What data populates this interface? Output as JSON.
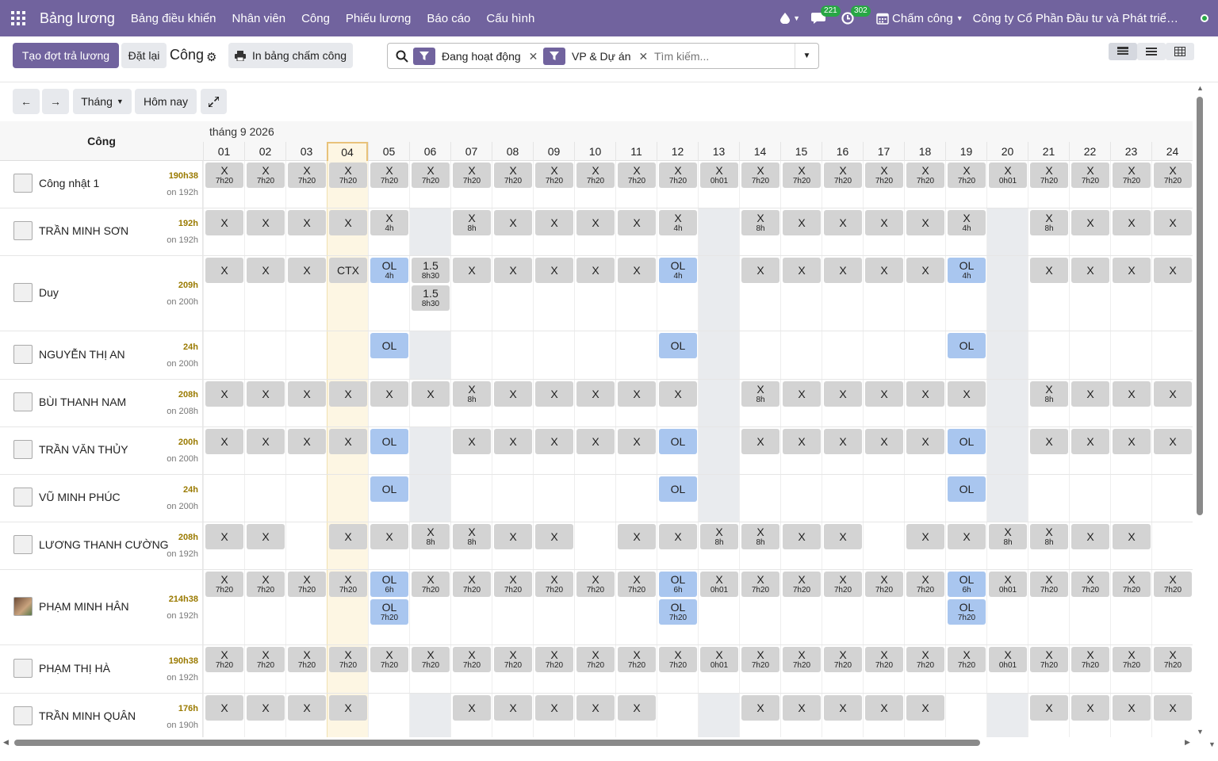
{
  "topbar": {
    "app_name": "Bảng lương",
    "menus": [
      "Bảng điều khiển",
      "Nhân viên",
      "Công",
      "Phiếu lương",
      "Báo cáo",
      "Cấu hình"
    ],
    "messages_count": "221",
    "activities_count": "302",
    "attendance_label": "Chấm công",
    "company": "Công ty Cổ Phần Đầu tư và Phát triể…",
    "accent": "#71639e"
  },
  "controls": {
    "create_payrun": "Tạo đợt trả lương",
    "reset": "Đặt lại",
    "title": "Công",
    "print": "In bảng chấm công"
  },
  "search": {
    "facets": [
      "Đang hoạt động",
      "VP & Dự án"
    ],
    "placeholder": "Tìm kiếm..."
  },
  "calendar": {
    "scale": "Tháng",
    "today": "Hôm nay",
    "month_label": "tháng 9 2026",
    "header_label": "Công",
    "days": [
      "01",
      "02",
      "03",
      "04",
      "05",
      "06",
      "07",
      "08",
      "09",
      "10",
      "11",
      "12",
      "13",
      "14",
      "15",
      "16",
      "17",
      "18",
      "19",
      "20",
      "21",
      "22",
      "23",
      "24"
    ],
    "today_index": 3,
    "off_days_note": "grey columns on days 06, 13, 20"
  },
  "employees": [
    {
      "name": "Công nhật 1",
      "hours": "190h38",
      "target": "on 192h",
      "avatar": "placeholder",
      "cells": [
        [
          "X",
          "7h20"
        ],
        [
          "X",
          "7h20"
        ],
        [
          "X",
          "7h20"
        ],
        [
          "X",
          "7h20"
        ],
        [
          "X",
          "7h20"
        ],
        [
          "X",
          "7h20"
        ],
        [
          "X",
          "7h20"
        ],
        [
          "X",
          "7h20"
        ],
        [
          "X",
          "7h20"
        ],
        [
          "X",
          "7h20"
        ],
        [
          "X",
          "7h20"
        ],
        [
          "X",
          "7h20"
        ],
        [
          "X",
          "0h01"
        ],
        [
          "X",
          "7h20"
        ],
        [
          "X",
          "7h20"
        ],
        [
          "X",
          "7h20"
        ],
        [
          "X",
          "7h20"
        ],
        [
          "X",
          "7h20"
        ],
        [
          "X",
          "7h20"
        ],
        [
          "X",
          "0h01"
        ],
        [
          "X",
          "7h20"
        ],
        [
          "X",
          "7h20"
        ],
        [
          "X",
          "7h20"
        ],
        [
          "X",
          "7h20"
        ]
      ]
    },
    {
      "name": "TRẦN MINH SƠN",
      "hours": "192h",
      "target": "on 192h",
      "avatar": "placeholder",
      "cells": [
        [
          "X",
          ""
        ],
        [
          "X",
          ""
        ],
        [
          "X",
          ""
        ],
        [
          "X",
          ""
        ],
        [
          "X",
          "4h"
        ],
        null,
        [
          "X",
          "8h"
        ],
        [
          "X",
          ""
        ],
        [
          "X",
          ""
        ],
        [
          "X",
          ""
        ],
        [
          "X",
          ""
        ],
        [
          "X",
          "4h"
        ],
        null,
        [
          "X",
          "8h"
        ],
        [
          "X",
          ""
        ],
        [
          "X",
          ""
        ],
        [
          "X",
          ""
        ],
        [
          "X",
          ""
        ],
        [
          "X",
          "4h"
        ],
        null,
        [
          "X",
          "8h"
        ],
        [
          "X",
          ""
        ],
        [
          "X",
          ""
        ],
        [
          "X",
          ""
        ]
      ]
    },
    {
      "name": "Duy",
      "hours": "209h",
      "target": "on 200h",
      "avatar": "placeholder",
      "cells": [
        [
          "X",
          ""
        ],
        [
          "X",
          ""
        ],
        [
          "X",
          ""
        ],
        [
          "CTX",
          ""
        ],
        [
          "OL",
          "4h"
        ],
        [
          "1.5",
          "8h30"
        ],
        [
          "X",
          ""
        ],
        [
          "X",
          ""
        ],
        [
          "X",
          ""
        ],
        [
          "X",
          ""
        ],
        [
          "X",
          ""
        ],
        [
          "OL",
          "4h"
        ],
        null,
        [
          "X",
          ""
        ],
        [
          "X",
          ""
        ],
        [
          "X",
          ""
        ],
        [
          "X",
          ""
        ],
        [
          "X",
          ""
        ],
        [
          "OL",
          "4h"
        ],
        null,
        [
          "X",
          ""
        ],
        [
          "X",
          ""
        ],
        [
          "X",
          ""
        ],
        [
          "X",
          ""
        ]
      ],
      "extra": {
        "day_index": 5,
        "label": "1.5",
        "sub": "8h30"
      }
    },
    {
      "name": "NGUYỄN THỊ AN",
      "hours": "24h",
      "target": "on 200h",
      "avatar": "placeholder",
      "cells": [
        null,
        null,
        null,
        null,
        [
          "OL",
          ""
        ],
        null,
        null,
        null,
        null,
        null,
        null,
        [
          "OL",
          ""
        ],
        null,
        null,
        null,
        null,
        null,
        null,
        [
          "OL",
          ""
        ],
        null,
        null,
        null,
        null,
        null
      ]
    },
    {
      "name": "BÙI THANH NAM",
      "hours": "208h",
      "target": "on 208h",
      "avatar": "placeholder",
      "cells": [
        [
          "X",
          ""
        ],
        [
          "X",
          ""
        ],
        [
          "X",
          ""
        ],
        [
          "X",
          ""
        ],
        [
          "X",
          ""
        ],
        [
          "X",
          ""
        ],
        [
          "X",
          "8h"
        ],
        [
          "X",
          ""
        ],
        [
          "X",
          ""
        ],
        [
          "X",
          ""
        ],
        [
          "X",
          ""
        ],
        [
          "X",
          ""
        ],
        null,
        [
          "X",
          "8h"
        ],
        [
          "X",
          ""
        ],
        [
          "X",
          ""
        ],
        [
          "X",
          ""
        ],
        [
          "X",
          ""
        ],
        [
          "X",
          ""
        ],
        null,
        [
          "X",
          "8h"
        ],
        [
          "X",
          ""
        ],
        [
          "X",
          ""
        ],
        [
          "X",
          ""
        ]
      ]
    },
    {
      "name": "TRẦN VĂN THỦY",
      "hours": "200h",
      "target": "on 200h",
      "avatar": "placeholder",
      "cells": [
        [
          "X",
          ""
        ],
        [
          "X",
          ""
        ],
        [
          "X",
          ""
        ],
        [
          "X",
          ""
        ],
        [
          "OL",
          ""
        ],
        null,
        [
          "X",
          ""
        ],
        [
          "X",
          ""
        ],
        [
          "X",
          ""
        ],
        [
          "X",
          ""
        ],
        [
          "X",
          ""
        ],
        [
          "OL",
          ""
        ],
        null,
        [
          "X",
          ""
        ],
        [
          "X",
          ""
        ],
        [
          "X",
          ""
        ],
        [
          "X",
          ""
        ],
        [
          "X",
          ""
        ],
        [
          "OL",
          ""
        ],
        null,
        [
          "X",
          ""
        ],
        [
          "X",
          ""
        ],
        [
          "X",
          ""
        ],
        [
          "X",
          ""
        ]
      ]
    },
    {
      "name": "VŨ MINH PHÚC",
      "hours": "24h",
      "target": "on 200h",
      "avatar": "placeholder",
      "cells": [
        null,
        null,
        null,
        null,
        [
          "OL",
          ""
        ],
        null,
        null,
        null,
        null,
        null,
        null,
        [
          "OL",
          ""
        ],
        null,
        null,
        null,
        null,
        null,
        null,
        [
          "OL",
          ""
        ],
        null,
        null,
        null,
        null,
        null
      ]
    },
    {
      "name": "LƯƠNG THANH CƯỜNG",
      "hours": "208h",
      "target": "on 192h",
      "avatar": "placeholder",
      "cells": [
        [
          "X",
          ""
        ],
        [
          "X",
          ""
        ],
        null,
        [
          "X",
          ""
        ],
        [
          "X",
          ""
        ],
        [
          "X",
          "8h"
        ],
        [
          "X",
          "8h"
        ],
        [
          "X",
          ""
        ],
        [
          "X",
          ""
        ],
        null,
        [
          "X",
          ""
        ],
        [
          "X",
          ""
        ],
        [
          "X",
          "8h"
        ],
        [
          "X",
          "8h"
        ],
        [
          "X",
          ""
        ],
        [
          "X",
          ""
        ],
        null,
        [
          "X",
          ""
        ],
        [
          "X",
          ""
        ],
        [
          "X",
          "8h"
        ],
        [
          "X",
          "8h"
        ],
        [
          "X",
          ""
        ],
        [
          "X",
          ""
        ],
        null
      ]
    },
    {
      "name": "PHẠM MINH HÂN",
      "hours": "214h38",
      "target": "on 192h",
      "avatar": "photo",
      "cells": [
        [
          "X",
          "7h20"
        ],
        [
          "X",
          "7h20"
        ],
        [
          "X",
          "7h20"
        ],
        [
          "X",
          "7h20"
        ],
        [
          "OL",
          "6h"
        ],
        [
          "X",
          "7h20"
        ],
        [
          "X",
          "7h20"
        ],
        [
          "X",
          "7h20"
        ],
        [
          "X",
          "7h20"
        ],
        [
          "X",
          "7h20"
        ],
        [
          "X",
          "7h20"
        ],
        [
          "OL",
          "6h"
        ],
        [
          "X",
          "0h01"
        ],
        [
          "X",
          "7h20"
        ],
        [
          "X",
          "7h20"
        ],
        [
          "X",
          "7h20"
        ],
        [
          "X",
          "7h20"
        ],
        [
          "X",
          "7h20"
        ],
        [
          "OL",
          "6h"
        ],
        [
          "X",
          "0h01"
        ],
        [
          "X",
          "7h20"
        ],
        [
          "X",
          "7h20"
        ],
        [
          "X",
          "7h20"
        ],
        [
          "X",
          "7h20"
        ]
      ],
      "extras": [
        {
          "day_index": 4,
          "label": "OL",
          "sub": "7h20"
        },
        {
          "day_index": 11,
          "label": "OL",
          "sub": "7h20"
        },
        {
          "day_index": 18,
          "label": "OL",
          "sub": "7h20"
        }
      ]
    },
    {
      "name": "PHẠM THỊ HÀ",
      "hours": "190h38",
      "target": "on 192h",
      "avatar": "placeholder",
      "cells": [
        [
          "X",
          "7h20"
        ],
        [
          "X",
          "7h20"
        ],
        [
          "X",
          "7h20"
        ],
        [
          "X",
          "7h20"
        ],
        [
          "X",
          "7h20"
        ],
        [
          "X",
          "7h20"
        ],
        [
          "X",
          "7h20"
        ],
        [
          "X",
          "7h20"
        ],
        [
          "X",
          "7h20"
        ],
        [
          "X",
          "7h20"
        ],
        [
          "X",
          "7h20"
        ],
        [
          "X",
          "7h20"
        ],
        [
          "X",
          "0h01"
        ],
        [
          "X",
          "7h20"
        ],
        [
          "X",
          "7h20"
        ],
        [
          "X",
          "7h20"
        ],
        [
          "X",
          "7h20"
        ],
        [
          "X",
          "7h20"
        ],
        [
          "X",
          "7h20"
        ],
        [
          "X",
          "0h01"
        ],
        [
          "X",
          "7h20"
        ],
        [
          "X",
          "7h20"
        ],
        [
          "X",
          "7h20"
        ],
        [
          "X",
          "7h20"
        ]
      ]
    },
    {
      "name": "TRẦN MINH QUÂN",
      "hours": "176h",
      "target": "on 190h",
      "avatar": "placeholder",
      "cells": [
        [
          "X",
          ""
        ],
        [
          "X",
          ""
        ],
        [
          "X",
          ""
        ],
        [
          "X",
          ""
        ],
        null,
        null,
        [
          "X",
          ""
        ],
        [
          "X",
          ""
        ],
        [
          "X",
          ""
        ],
        [
          "X",
          ""
        ],
        [
          "X",
          ""
        ],
        null,
        null,
        [
          "X",
          ""
        ],
        [
          "X",
          ""
        ],
        [
          "X",
          ""
        ],
        [
          "X",
          ""
        ],
        [
          "X",
          ""
        ],
        null,
        null,
        [
          "X",
          ""
        ],
        [
          "X",
          ""
        ],
        [
          "X",
          ""
        ],
        [
          "X",
          ""
        ]
      ]
    }
  ]
}
